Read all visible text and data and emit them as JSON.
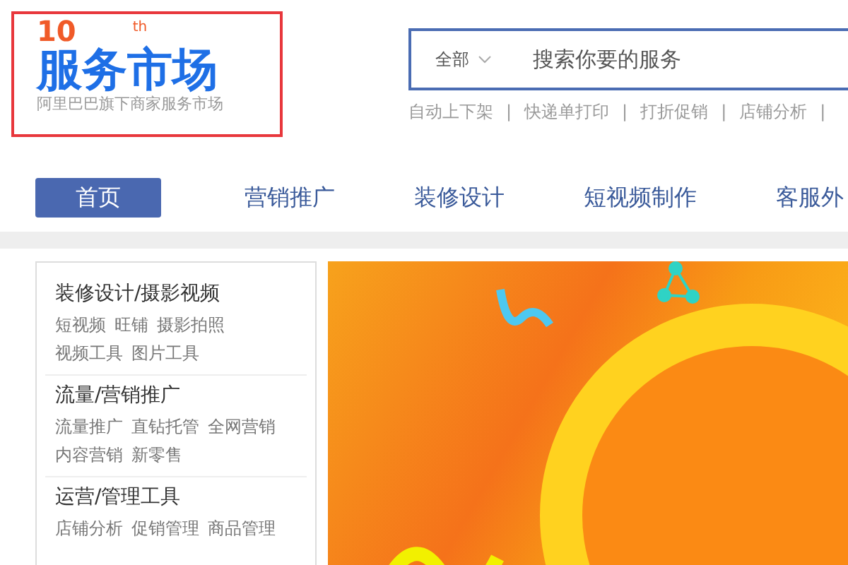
{
  "logo": {
    "badge": "10",
    "badge_suffix": "th",
    "title": "服务市场",
    "subtitle": "阿里巴巴旗下商家服务市场"
  },
  "search": {
    "category": "全部",
    "placeholder": "搜索你要的服务"
  },
  "hot_links": [
    {
      "kind": "link",
      "text": "自动上下架"
    },
    {
      "kind": "separator",
      "text": "|"
    },
    {
      "kind": "link",
      "text": "快递单打印"
    },
    {
      "kind": "separator",
      "text": "|"
    },
    {
      "kind": "link",
      "text": "打折促销"
    },
    {
      "kind": "separator",
      "text": "|"
    },
    {
      "kind": "link",
      "text": "店铺分析"
    },
    {
      "kind": "separator",
      "text": "|"
    }
  ],
  "nav": [
    {
      "label": "首页",
      "selected": true
    },
    {
      "label": "营销推广",
      "selected": false
    },
    {
      "label": "装修设计",
      "selected": false
    },
    {
      "label": "短视频制作",
      "selected": false
    },
    {
      "label": "客服外",
      "selected": false
    }
  ],
  "sidebar": [
    {
      "title": "装修设计/摄影视频",
      "items": [
        "短视频",
        "旺铺",
        "摄影拍照",
        "视频工具",
        "图片工具"
      ]
    },
    {
      "title": "流量/营销推广",
      "items": [
        "流量推广",
        "直钻托管",
        "全网营销",
        "内容营销",
        "新零售"
      ]
    },
    {
      "title": "运营/管理工具",
      "items": [
        "店铺分析",
        "促销管理",
        "商品管理"
      ]
    }
  ]
}
